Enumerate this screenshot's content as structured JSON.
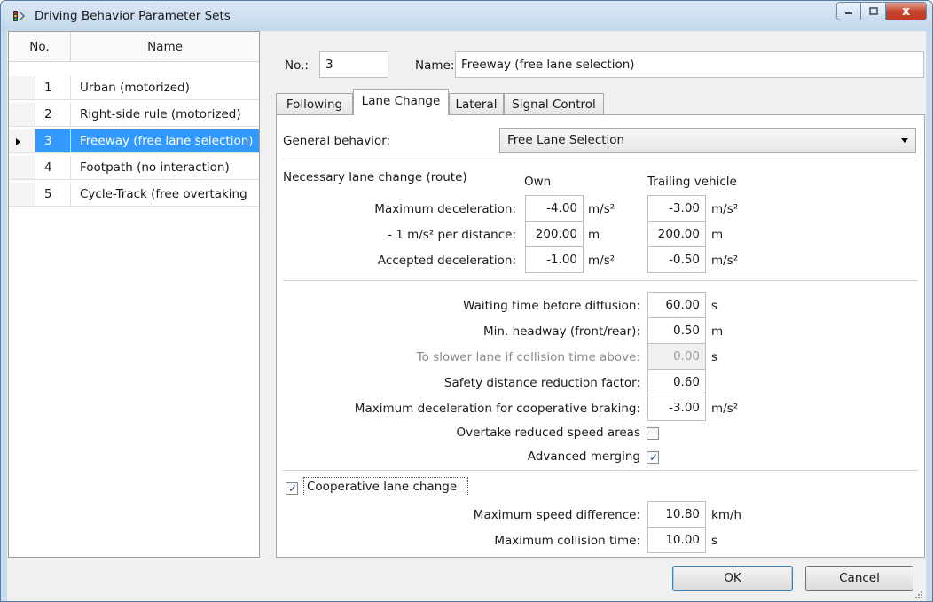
{
  "window": {
    "title": "Driving Behavior Parameter Sets",
    "close_glyph": "x"
  },
  "list": {
    "columns": [
      "No.",
      "Name"
    ],
    "rows": [
      {
        "no": "1",
        "name": "Urban (motorized)"
      },
      {
        "no": "2",
        "name": "Right-side rule (motorized)"
      },
      {
        "no": "3",
        "name": "Freeway (free lane selection)"
      },
      {
        "no": "4",
        "name": "Footpath (no interaction)"
      },
      {
        "no": "5",
        "name": "Cycle-Track (free overtaking"
      }
    ],
    "selected_index": 2
  },
  "header": {
    "no_label": "No.:",
    "no_value": "3",
    "name_label": "Name:",
    "name_value": "Freeway (free lane selection)"
  },
  "tabs": [
    "Following",
    "Lane Change",
    "Lateral",
    "Signal Control"
  ],
  "active_tab": "Lane Change",
  "lane_change": {
    "general_behavior_label": "General behavior:",
    "general_behavior_value": "Free Lane Selection",
    "necessary_label": "Necessary lane change (route)",
    "own_header": "Own",
    "trailing_header": "Trailing vehicle",
    "params": [
      {
        "label": "Maximum deceleration:",
        "own": "-4.00",
        "own_unit": "m/s²",
        "trailing": "-3.00",
        "trailing_unit": "m/s²"
      },
      {
        "label": "- 1 m/s² per distance:",
        "own": "200.00",
        "own_unit": "m",
        "trailing": "200.00",
        "trailing_unit": "m"
      },
      {
        "label": "Accepted deceleration:",
        "own": "-1.00",
        "own_unit": "m/s²",
        "trailing": "-0.50",
        "trailing_unit": "m/s²"
      }
    ],
    "misc": [
      {
        "label": "Waiting time before diffusion:",
        "value": "60.00",
        "unit": "s",
        "disabled": false
      },
      {
        "label": "Min. headway (front/rear):",
        "value": "0.50",
        "unit": "m",
        "disabled": false
      },
      {
        "label": "To slower lane if collision time above:",
        "value": "0.00",
        "unit": "s",
        "disabled": true
      },
      {
        "label": "Safety distance reduction factor:",
        "value": "0.60",
        "unit": "",
        "disabled": false
      },
      {
        "label": "Maximum deceleration for cooperative braking:",
        "value": "-3.00",
        "unit": "m/s²",
        "disabled": false
      }
    ],
    "overtake_reduced_label": "Overtake reduced speed areas",
    "overtake_reduced_checked": false,
    "advanced_merging_label": "Advanced merging",
    "advanced_merging_checked": true,
    "cooperative_label": "Cooperative lane change",
    "cooperative_checked": true,
    "coop_params": [
      {
        "label": "Maximum speed difference:",
        "value": "10.80",
        "unit": "km/h"
      },
      {
        "label": "Maximum collision time:",
        "value": "10.00",
        "unit": "s"
      }
    ]
  },
  "buttons": {
    "ok": "OK",
    "cancel": "Cancel"
  },
  "colors": {
    "selection": "#3399ff",
    "titlebar": "#c3d7ec",
    "close": "#c7442c"
  }
}
